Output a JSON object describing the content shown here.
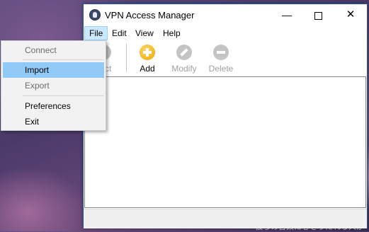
{
  "window": {
    "title": "VPN Access Manager",
    "controls": {
      "minimize": "—",
      "close": "✕"
    }
  },
  "menubar": {
    "items": [
      "File",
      "Edit",
      "View",
      "Help"
    ],
    "active": "File"
  },
  "toolbar": {
    "connect": {
      "label": "nect",
      "icon": "connect-icon",
      "enabled": false
    },
    "add": {
      "label": "Add",
      "icon": "add-icon",
      "enabled": true
    },
    "modify": {
      "label": "Modify",
      "icon": "wrench-icon",
      "enabled": false
    },
    "delete": {
      "label": "Delete",
      "icon": "minus-icon",
      "enabled": false
    }
  },
  "file_menu": {
    "items": [
      {
        "label": "Connect",
        "enabled": false
      },
      {
        "label": "Import",
        "enabled": true,
        "highlighted": true
      },
      {
        "label": "Export",
        "enabled": false
      },
      {
        "label": "Preferences",
        "enabled": true
      },
      {
        "label": "Exit",
        "enabled": true
      }
    ]
  },
  "desktop": {
    "wallpaper_text": "被らの音楽に心をうたれる人が"
  },
  "colors": {
    "menu_highlight": "#91c9f7",
    "active_menu_bg": "#cce8ff",
    "add_icon": "#f0a500",
    "disabled_text": "#a0a0a0"
  }
}
